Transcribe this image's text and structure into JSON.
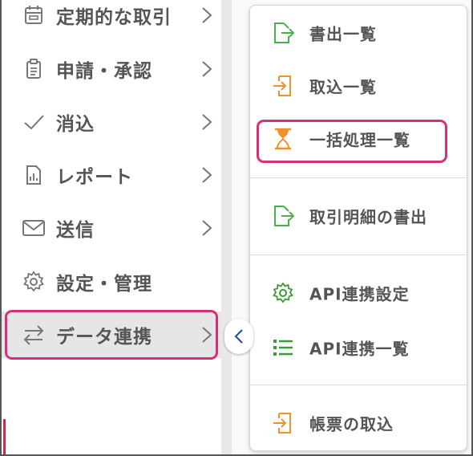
{
  "sidebar": {
    "items": [
      {
        "label": "定期的な取引",
        "icon": "calendar-icon"
      },
      {
        "label": "申請・承認",
        "icon": "clipboard-icon"
      },
      {
        "label": "消込",
        "icon": "check-icon"
      },
      {
        "label": "レポート",
        "icon": "report-icon"
      },
      {
        "label": "送信",
        "icon": "mail-icon"
      },
      {
        "label": "設定・管理",
        "icon": "gear-icon"
      },
      {
        "label": "データ連携",
        "icon": "sync-arrows-icon"
      }
    ]
  },
  "popup_menu": {
    "items": [
      {
        "label": "書出一覧",
        "icon": "export-icon"
      },
      {
        "label": "取込一覧",
        "icon": "import-icon"
      },
      {
        "label": "一括処理一覧",
        "icon": "hourglass-icon"
      },
      {
        "label": "取引明細の書出",
        "icon": "export-icon"
      },
      {
        "label": "API連携設定",
        "icon": "gear-icon"
      },
      {
        "label": "API連携一覧",
        "icon": "list-icon"
      },
      {
        "label": "帳票の取込",
        "icon": "import-icon"
      }
    ]
  },
  "colors": {
    "highlight": "#d6307a",
    "export_green": "#4caf50",
    "import_orange": "#f0922b",
    "hourglass_orange": "#f0922b",
    "api_green": "#3a9a3a",
    "text": "#555555"
  }
}
